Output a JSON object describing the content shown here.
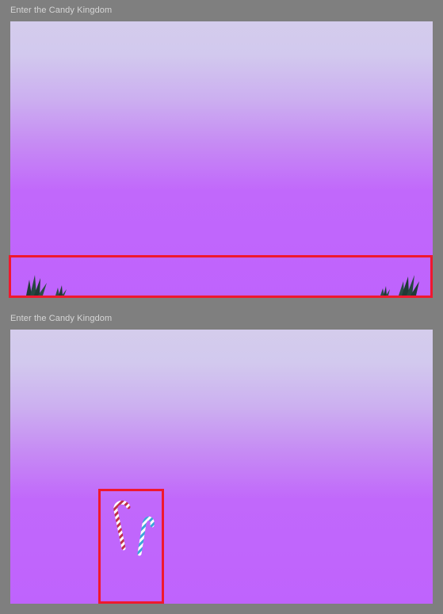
{
  "frames": [
    {
      "label": "Enter the Candy Kingdom",
      "highlight_target": "grass-strip"
    },
    {
      "label": "Enter the Candy Kingdom",
      "highlight_target": "candy-canes"
    }
  ],
  "colors": {
    "background": "#7f7f7f",
    "sky_top": "#d4ccec",
    "sky_bottom": "#bf63fd",
    "highlight": "#f0182e",
    "grass": "#1f3a36",
    "cane_red": "#c0304a",
    "cane_blue": "#3aa7d8"
  },
  "icons": {
    "grass": "grass-tuft-icon",
    "cane_red": "red-candy-cane-icon",
    "cane_blue": "blue-candy-cane-icon"
  }
}
